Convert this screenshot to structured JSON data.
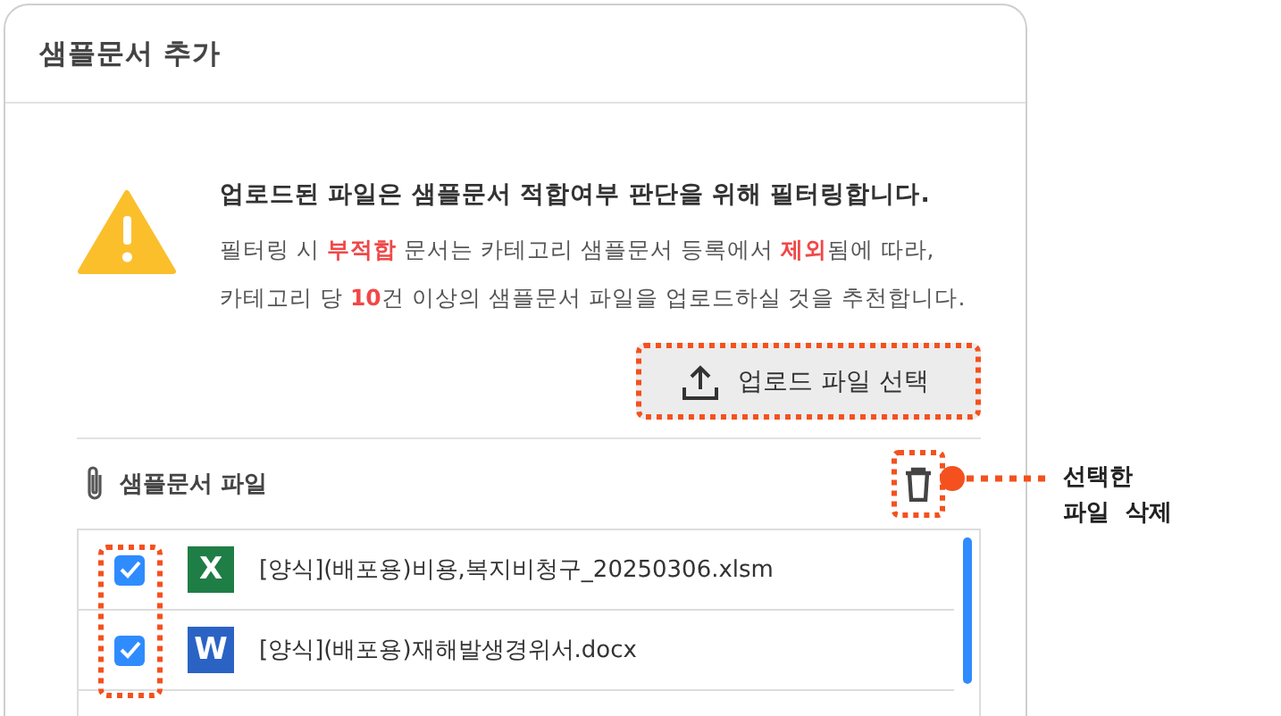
{
  "dialog": {
    "title": "샘플문서 추가"
  },
  "notice": {
    "heading": "업로드된 파일은 샘플문서 적합여부 판단을 위해 필터링합니다.",
    "lines": [
      "필터링 시 **부적합** 문서는 카테고리 샘플문서 등록에서 **제외**됨에 따라,",
      "카테고리 당 **10**건 이상의 샘플문서 파일을 업로드하실 것을 추천합니다."
    ]
  },
  "upload_button": {
    "label": "업로드 파일 선택",
    "highlighted": true
  },
  "files_section": {
    "label": "샘플문서 파일",
    "delete_highlighted": true,
    "checkboxes_highlighted": true
  },
  "callout": {
    "lines": [
      "선택한",
      "파일  삭제"
    ]
  },
  "files": [
    {
      "name": "[양식](배포용)비용,복지비청구_20250306.xlsm",
      "kind": "excel",
      "icon_letter": "X",
      "checked": true
    },
    {
      "name": "[양식](배포용)재해발생경위서.docx",
      "kind": "word",
      "icon_letter": "W",
      "checked": true
    }
  ]
}
